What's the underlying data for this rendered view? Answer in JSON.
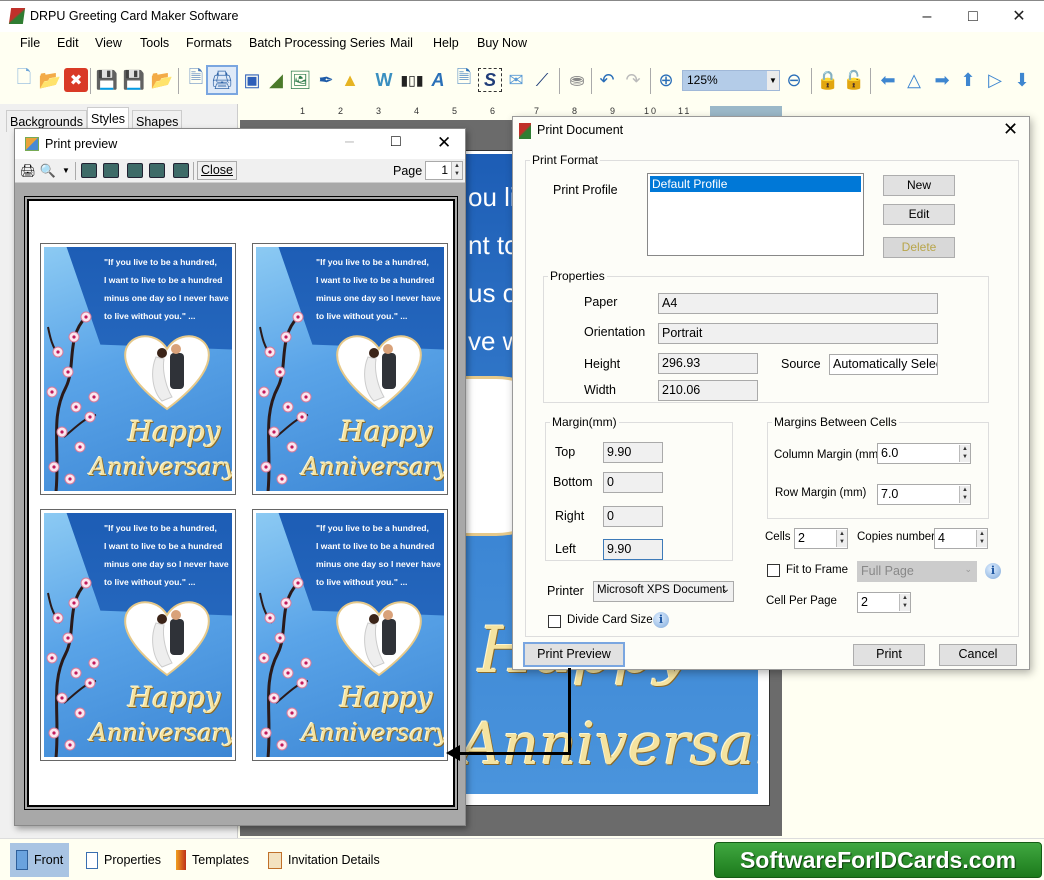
{
  "app": {
    "title": "DRPU Greeting Card Maker Software",
    "window_controls": [
      "minimize",
      "maximize",
      "close"
    ]
  },
  "menu": [
    "File",
    "Edit",
    "View",
    "Tools",
    "Formats",
    "Batch Processing Series",
    "Mail",
    "Help",
    "Buy Now"
  ],
  "toolbar": {
    "icons": [
      "new-icon",
      "open-icon",
      "close-file-icon",
      "save-icon",
      "save-as-icon",
      "export-icon",
      "print-preview-icon",
      "print-icon",
      "copy-design-icon",
      "background-icon",
      "insert-image-icon",
      "signature-pen-icon",
      "shapes-icon",
      "watermark-icon",
      "barcode-icon",
      "text-icon",
      "word-art-icon",
      "select-icon",
      "email-icon",
      "line-icon",
      "database-icon",
      "undo-icon",
      "redo-icon",
      "zoom-in-icon",
      "zoom-out-icon",
      "lock-icon",
      "unlock-icon",
      "move-left-icon",
      "flip-horizontal-icon",
      "move-right-icon",
      "move-up-icon",
      "flip-vertical-icon",
      "move-down-icon"
    ],
    "zoom_value": "125%"
  },
  "left_panel": {
    "tabs": [
      "Backgrounds",
      "Styles",
      "Shapes"
    ],
    "active_tab": "Styles"
  },
  "ruler": {
    "labels": [
      "1",
      "2",
      "3",
      "4",
      "5",
      "6",
      "7",
      "8",
      "9",
      "10",
      "11"
    ]
  },
  "canvas_card": {
    "lines": [
      "ou liv",
      "nt to",
      "us or",
      "ve wi"
    ],
    "happy": "Happy",
    "anniversary": "Anniversary"
  },
  "print_preview": {
    "title": "Print preview",
    "close_label": "Close",
    "page_label": "Page",
    "page_value": "1",
    "card": {
      "quote_lines": [
        "\"If you live to be a hundred,",
        "I want to live to be a hundred",
        "minus one day so I never have",
        "to live without you.\" ..."
      ],
      "happy": "Happy",
      "anniversary": "Anniversary"
    },
    "card_count": 4
  },
  "print_document": {
    "title": "Print Document",
    "print_format_legend": "Print Format",
    "print_profile_label": "Print Profile",
    "profiles": [
      "Default Profile"
    ],
    "selected_profile": "Default Profile",
    "new_label": "New",
    "edit_label": "Edit",
    "delete_label": "Delete",
    "properties_legend": "Properties",
    "paper_label": "Paper",
    "paper_value": "A4",
    "orientation_label": "Orientation",
    "orientation_value": "Portrait",
    "height_label": "Height",
    "height_value": "296.93",
    "width_label": "Width",
    "width_value": "210.06",
    "source_label": "Source",
    "source_value": "Automatically Selec",
    "margin_legend": "Margin(mm)",
    "top_label": "Top",
    "top_value": "9.90",
    "bottom_label": "Bottom",
    "bottom_value": "0",
    "right_label": "Right",
    "right_value": "0",
    "left_label": "Left",
    "left_value": "9.90",
    "cells_margin_legend": "Margins Between Cells",
    "column_margin_label": "Column Margin (mm)",
    "column_margin_value": "6.0",
    "row_margin_label": "Row Margin (mm)",
    "row_margin_value": "7.0",
    "cells_label": "Cells",
    "cells_value": "2",
    "copies_label": "Copies number",
    "copies_value": "4",
    "fit_to_frame_label": "Fit to Frame",
    "fit_to_frame_checked": false,
    "fit_option_value": "Full Page",
    "cell_per_page_label": "Cell Per Page",
    "cell_per_page_value": "2",
    "printer_label": "Printer",
    "printer_value": "Microsoft XPS Document",
    "divide_card_label": "Divide Card Size",
    "divide_card_checked": false,
    "print_preview_label": "Print Preview",
    "print_label": "Print",
    "cancel_label": "Cancel"
  },
  "bottom_tabs": [
    {
      "label": "Front",
      "icon": "front-page-icon",
      "active": true
    },
    {
      "label": "Properties",
      "icon": "properties-icon",
      "active": false
    },
    {
      "label": "Templates",
      "icon": "templates-icon",
      "active": false
    },
    {
      "label": "Invitation Details",
      "icon": "invitation-details-icon",
      "active": false
    }
  ],
  "watermark": "SoftwareForIDCards.com"
}
